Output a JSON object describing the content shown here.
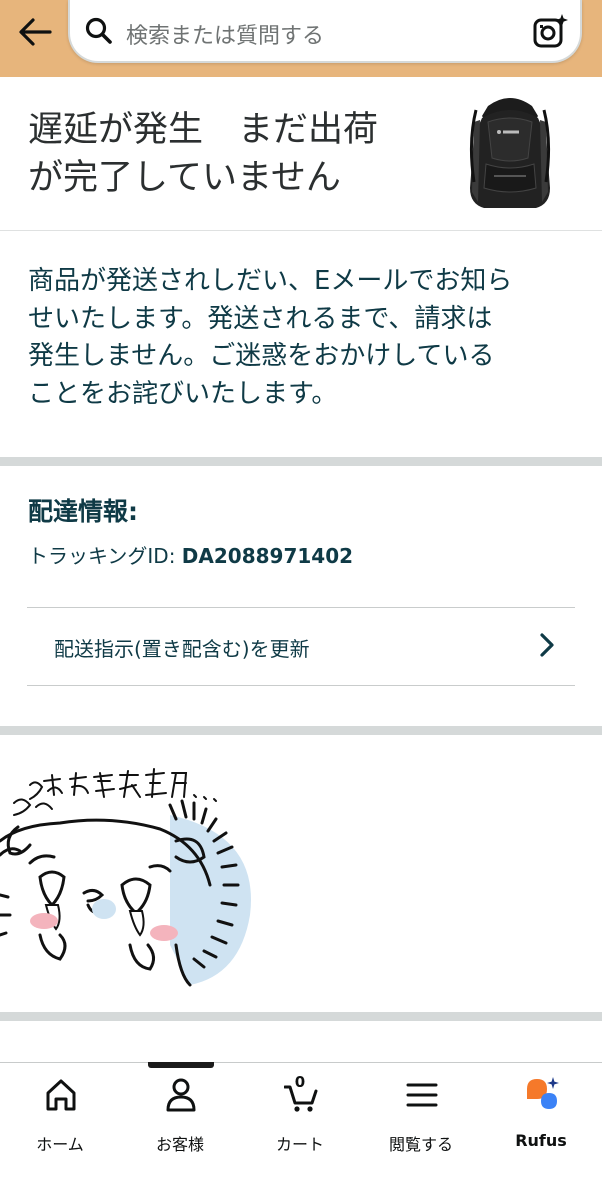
{
  "header": {
    "back_icon": "arrow-left-icon",
    "search_placeholder": "検索または質問する",
    "search_icon": "search-icon",
    "camera_icon": "camera-icon",
    "bar_color": "#e7b57c"
  },
  "status": {
    "title_line1": "遅延が発生　まだ出荷",
    "title_line2": "が完了していません",
    "product_image": "black-backpack"
  },
  "message": {
    "line1": "商品が発送されしだい、Eメールでお知ら",
    "line2": "せいたします。発送されるまで、請求は",
    "line3": "発生しません。ご迷惑をおかけしている",
    "line4": "ことをお詫びいたします。"
  },
  "delivery": {
    "title": "配達情報:",
    "tracking_label": "トラッキングID:",
    "tracking_id": "DA2088971402",
    "instruction_label": "配送指示(置き配含む)を更新",
    "instruction_icon": "chevron-right-icon"
  },
  "illustration": {
    "handwritten_text": "お届け先住所 うえぇ..."
  },
  "bottom_nav": {
    "items": [
      {
        "label": "ホーム",
        "icon": "home-icon"
      },
      {
        "label": "お客様",
        "icon": "person-icon"
      },
      {
        "label": "カート",
        "icon": "cart-icon",
        "count": "0"
      },
      {
        "label": "閲覧する",
        "icon": "menu-icon"
      },
      {
        "label": "Rufus",
        "icon": "rufus-icon"
      }
    ]
  }
}
